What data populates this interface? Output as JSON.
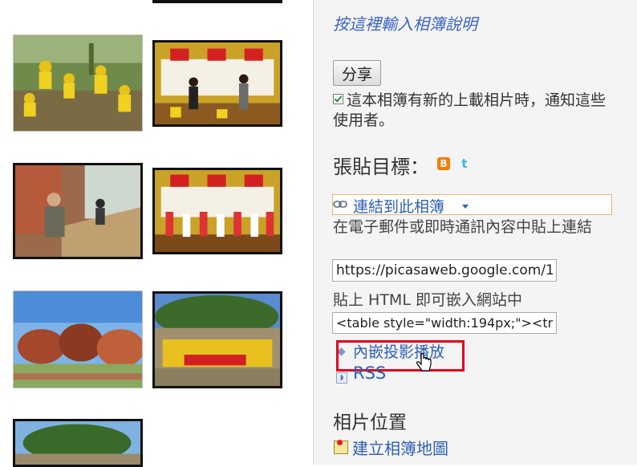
{
  "sidebar": {
    "album_description_link": "按這裡輸入相簿說明",
    "share_button": "分享",
    "notify_text": "這本相簿有新的上載相片時，通知這些使用者。",
    "post_to_title": "張貼目標：",
    "link_to_album": "連結到此相簿",
    "email_im_help": "在電子郵件或即時通訊內容中貼上連結",
    "album_url": "https://picasaweb.google.com/1",
    "html_embed_help": "貼上 HTML 即可嵌入網站中",
    "html_embed_code": "<table style=\"width:194px;\"><tr",
    "embed_slideshow": "內嵌投影播放",
    "rss": "RSS",
    "photo_location_title": "相片位置",
    "create_album_map": "建立相簿地圖"
  },
  "icons": {
    "blogger": "blogger-icon",
    "twitter": "twitter-icon",
    "link": "link-icon",
    "rss": "rss-icon",
    "map": "map-icon"
  },
  "colors": {
    "link": "#2d5fb5",
    "highlight": "#e0001b",
    "link_box_border": "#e8b86a"
  }
}
